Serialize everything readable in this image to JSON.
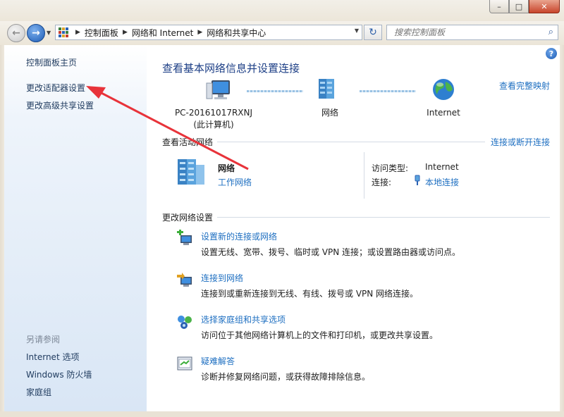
{
  "window": {
    "min_glyph": "–",
    "max_glyph": "□",
    "close_glyph": "✕"
  },
  "nav": {
    "back_glyph": "←",
    "forward_glyph": "→",
    "dropdown_glyph": "▼"
  },
  "address": {
    "crumbs": [
      "控制面板",
      "网络和 Internet",
      "网络和共享中心"
    ],
    "sep": "▶",
    "dropdown_glyph": "▼",
    "refresh_glyph": "↻"
  },
  "search": {
    "placeholder": "搜索控制面板",
    "icon_glyph": "⌕"
  },
  "sidebar": {
    "items": [
      {
        "label": "控制面板主页"
      },
      {
        "label": "更改适配器设置"
      },
      {
        "label": "更改高级共享设置"
      }
    ],
    "see_also_heading": "另请参阅",
    "see_also": [
      {
        "label": "Internet 选项"
      },
      {
        "label": "Windows 防火墙"
      },
      {
        "label": "家庭组"
      }
    ]
  },
  "main": {
    "help_glyph": "?",
    "title": "查看基本网络信息并设置连接",
    "full_map_link": "查看完整映射",
    "network_map": {
      "computer_name": "PC-20161017RXNJ",
      "computer_sub": "(此计算机)",
      "network_label": "网络",
      "internet_label": "Internet"
    },
    "active_section": {
      "title": "查看活动网络",
      "connect_link": "连接或断开连接",
      "network_name": "网络",
      "network_type": "工作网络",
      "access_type_label": "访问类型:",
      "access_type_value": "Internet",
      "connections_label": "连接:",
      "connections_value": "本地连接"
    },
    "change_section": {
      "title": "更改网络设置",
      "tasks": [
        {
          "title": "设置新的连接或网络",
          "desc": "设置无线、宽带、拨号、临时或 VPN 连接；或设置路由器或访问点。",
          "icon": "new-connection-icon"
        },
        {
          "title": "连接到网络",
          "desc": "连接到或重新连接到无线、有线、拨号或 VPN 网络连接。",
          "icon": "connect-network-icon"
        },
        {
          "title": "选择家庭组和共享选项",
          "desc": "访问位于其他网络计算机上的文件和打印机，或更改共享设置。",
          "icon": "homegroup-icon"
        },
        {
          "title": "疑难解答",
          "desc": "诊断并修复网络问题，或获得故障排除信息。",
          "icon": "troubleshoot-icon"
        }
      ]
    }
  },
  "colors": {
    "link": "#1e6fc1",
    "title": "#1d3f86",
    "annotation_arrow": "#e8333a"
  }
}
